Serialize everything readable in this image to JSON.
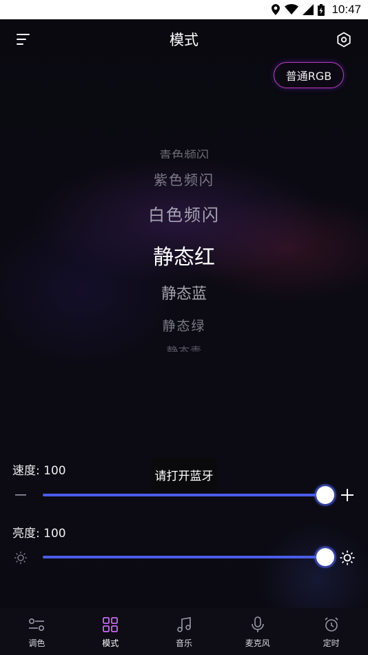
{
  "status_bar": {
    "time": "10:47"
  },
  "app_bar": {
    "title": "模式"
  },
  "rgb_button": {
    "label": "普通RGB"
  },
  "mode_picker": {
    "items": [
      "青色频闪",
      "紫色频闪",
      "白色频闪",
      "静态红",
      "静态蓝",
      "静态绿",
      "静态青"
    ],
    "selected": "静态红"
  },
  "speed": {
    "label": "速度: 100",
    "value": 100,
    "max": 100
  },
  "brightness": {
    "label": "亮度: 100",
    "value": 100,
    "max": 100
  },
  "toast": {
    "text": "请打开蓝牙"
  },
  "tabs": [
    {
      "label": "调色",
      "icon": "sliders-icon",
      "active": false
    },
    {
      "label": "模式",
      "icon": "grid-icon",
      "active": true
    },
    {
      "label": "音乐",
      "icon": "music-note-icon",
      "active": false
    },
    {
      "label": "麦克风",
      "icon": "microphone-icon",
      "active": false
    },
    {
      "label": "定时",
      "icon": "alarm-clock-icon",
      "active": false
    }
  ],
  "colors": {
    "accent": "#4a5ee8",
    "active_tab": "#c86af0",
    "rgb_border": "#c23ac6"
  }
}
